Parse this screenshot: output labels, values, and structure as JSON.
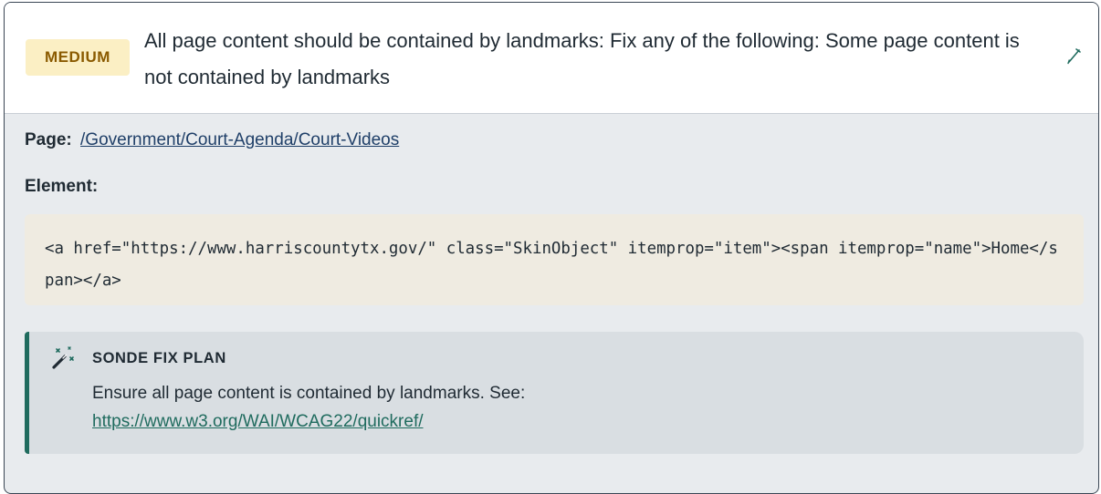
{
  "issue": {
    "severity": "MEDIUM",
    "title": "All page content should be contained by landmarks: Fix any of the following: Some page content is not contained by landmarks",
    "edit_icon": "pencil-icon"
  },
  "details": {
    "page_label": "Page:",
    "page_link": "/Government/Court-Agenda/Court-Videos",
    "element_label": "Element:",
    "element_code": "<a href=\"https://www.harriscountytx.gov/\" class=\"SkinObject\" itemprop=\"item\"><span itemprop=\"name\">Home</span></a>"
  },
  "fix_plan": {
    "icon": "magic-wand-icon",
    "heading": "SONDE FIX PLAN",
    "text": "Ensure all page content is contained by landmarks. See:",
    "link": "https://www.w3.org/WAI/WCAG22/quickref/"
  },
  "colors": {
    "badge_bg": "#fbefc4",
    "badge_text": "#8a5a00",
    "accent": "#1f6b5e",
    "link": "#1f3f68",
    "code_bg": "#efebe1"
  }
}
